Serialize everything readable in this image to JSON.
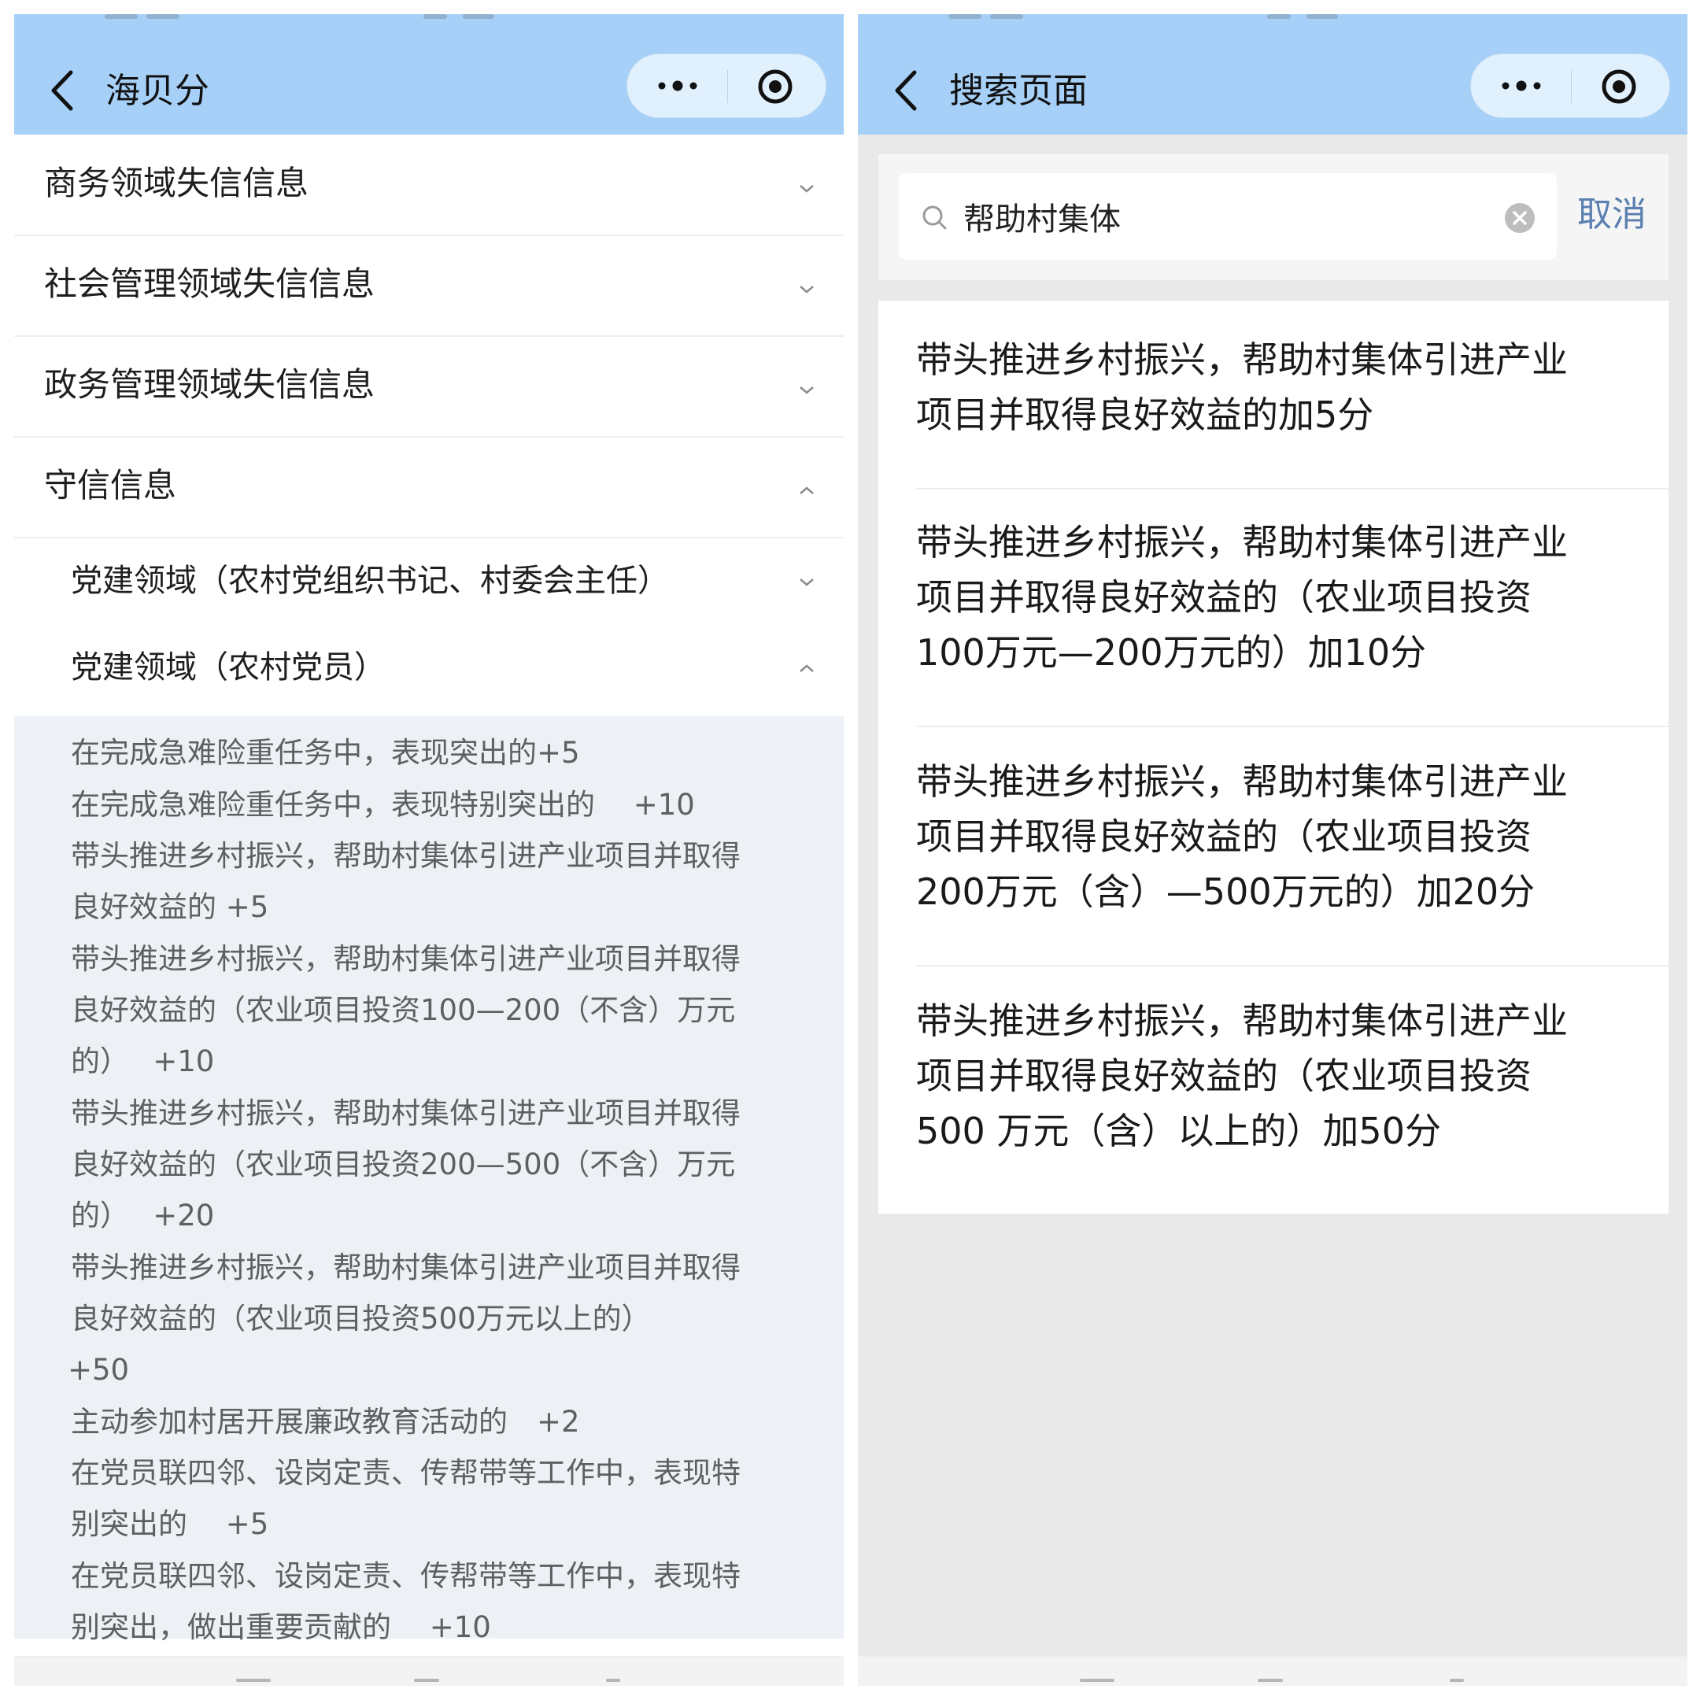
{
  "left": {
    "header": {
      "title": "海贝分"
    },
    "sections": [
      {
        "label": "商务领域失信信息",
        "expanded": false
      },
      {
        "label": "社会管理领域失信信息",
        "expanded": false
      },
      {
        "label": "政务管理领域失信信息",
        "expanded": false
      },
      {
        "label": "守信信息",
        "expanded": true
      }
    ],
    "subsections": [
      {
        "label": "党建领域（农村党组织书记、村委会主任）",
        "expanded": false
      },
      {
        "label": "党建领域（农村党员）",
        "expanded": true
      }
    ],
    "content_lines": [
      "在完成急难险重任务中，表现突出的+5",
      "在完成急难险重任务中，表现特别突出的　 +10",
      "带头推进乡村振兴，帮助村集体引进产业项目并取得",
      "良好效益的 +5",
      "带头推进乡村振兴，帮助村集体引进产业项目并取得",
      "良好效益的（农业项目投资100—200（不含）万元",
      "的）　 +10",
      "带头推进乡村振兴，帮助村集体引进产业项目并取得",
      "良好效益的（农业项目投资200—500（不含）万元",
      "的）　 +20",
      "带头推进乡村振兴，帮助村集体引进产业项目并取得",
      "良好效益的（农业项目投资500万元以上的）",
      "+50",
      "主动参加村居开展廉政教育活动的　+2",
      "在党员联四邻、设岗定责、传帮带等工作中，表现特",
      "别突出的　 +5",
      "在党员联四邻、设岗定责、传帮带等工作中，表现特",
      "别突出，做出重要贡献的　 +10"
    ]
  },
  "right": {
    "header": {
      "title": "搜索页面"
    },
    "search": {
      "value": "帮助村集体",
      "cancel_label": "取消"
    },
    "results": [
      {
        "lines": [
          "带头推进乡村振兴，帮助村集体引进产业",
          "项目并取得良好效益的加5分"
        ]
      },
      {
        "lines": [
          "带头推进乡村振兴，帮助村集体引进产业",
          "项目并取得良好效益的（农业项目投资",
          "100万元—200万元的）加10分"
        ]
      },
      {
        "lines": [
          "带头推进乡村振兴，帮助村集体引进产业",
          "项目并取得良好效益的（农业项目投资",
          "200万元（含）—500万元的）加20分"
        ]
      },
      {
        "lines": [
          "带头推进乡村振兴，帮助村集体引进产业",
          "项目并取得良好效益的（农业项目投资",
          "500 万元（含）以上的）加50分"
        ]
      }
    ]
  },
  "icons": {
    "back": "chevron-left-icon",
    "more": "more-dots-icon",
    "record": "record-target-icon",
    "search": "search-icon",
    "clear": "clear-circle-icon",
    "chevron_down": "chevron-down-icon",
    "chevron_up": "chevron-up-icon"
  },
  "colors": {
    "header_bg": "#a6d0f8",
    "capsule_bg": "#e1f0fd",
    "content_panel_bg": "#edf1f5",
    "page_gray_bg": "#e9e9e9",
    "cancel_link": "#5a7fb0"
  }
}
